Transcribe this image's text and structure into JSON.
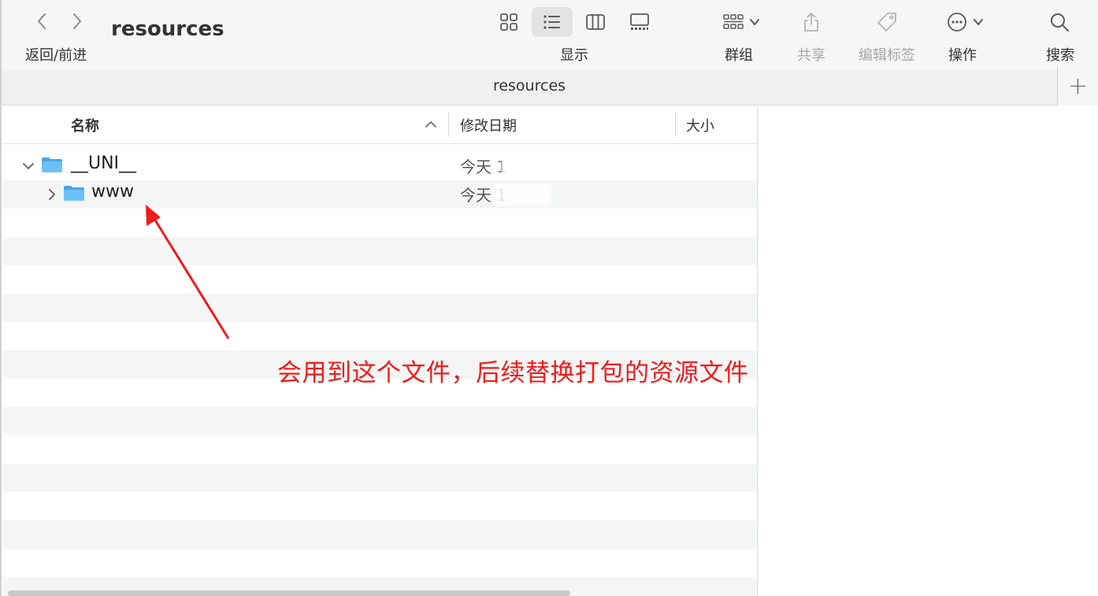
{
  "toolbar": {
    "nav_label": "返回/前进",
    "window_title": "resources",
    "view_label": "显示",
    "group_label": "群组",
    "share_label": "共享",
    "tags_label": "编辑标签",
    "action_label": "操作",
    "search_label": "搜索"
  },
  "tabbar": {
    "title": "resources",
    "add_symbol": "+"
  },
  "list": {
    "columns": {
      "name": "名称",
      "modified": "修改日期",
      "size": "大小"
    },
    "rows": [
      {
        "name": "__UNI__",
        "date": "今天 1",
        "expanded": true
      },
      {
        "name": "www",
        "date": "今天 1",
        "expanded": false
      }
    ]
  },
  "annotation": {
    "text": "会用到这个文件，后续替换打包的资源文件",
    "color": "#f21a1a"
  },
  "icons": {
    "back": "chevron-left-icon",
    "forward": "chevron-right-icon",
    "folder": "folder-icon",
    "search": "magnifier-icon"
  }
}
